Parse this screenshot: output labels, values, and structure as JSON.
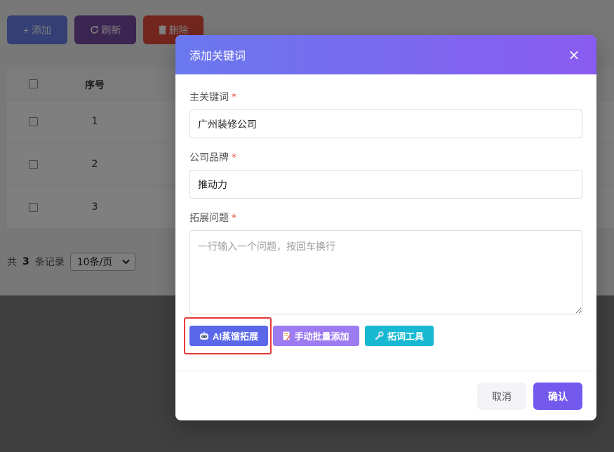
{
  "toolbar": {
    "add_label": "+ 添加",
    "refresh_label": "刷新",
    "delete_label": "删除"
  },
  "table": {
    "headers": {
      "index": "序号"
    },
    "rows": [
      {
        "index": "1"
      },
      {
        "index": "2"
      },
      {
        "index": "3"
      }
    ]
  },
  "pagination": {
    "prefix": "共",
    "count": "3",
    "suffix": "条记录",
    "page_size": "10条/页"
  },
  "modal": {
    "title": "添加关键词",
    "close": "×",
    "fields": {
      "main_keyword": {
        "label": "主关键词",
        "required": "*",
        "value": "广州装修公司"
      },
      "brand": {
        "label": "公司品牌",
        "required": "*",
        "value": "推动力"
      },
      "questions": {
        "label": "拓展问题",
        "required": "*",
        "placeholder": "一行输入一个问题，按回车换行"
      }
    },
    "actions": {
      "ai_label": "AI蒸馏拓展",
      "manual_label": "手动批量添加",
      "tool_label": "拓词工具"
    },
    "footer": {
      "cancel_label": "取消",
      "confirm_label": "确认"
    }
  },
  "colors": {
    "primary": "#667eea",
    "accent": "#764ba2",
    "danger": "#e74c3c",
    "highlight": "#e53935",
    "info": "#17b8d2"
  },
  "icons": {
    "refresh": "refresh-icon",
    "delete": "trash-icon",
    "ai": "robot-icon",
    "manual": "memo-icon",
    "tool": "wrench-icon",
    "close": "close-icon"
  }
}
